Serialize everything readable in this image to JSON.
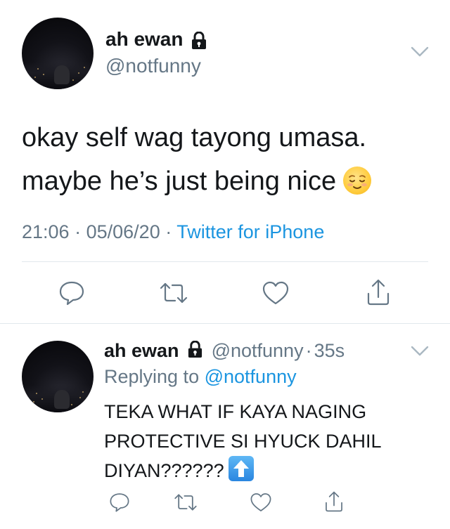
{
  "main_tweet": {
    "display_name": "ah ewan",
    "handle": "@notfunny",
    "text_line1": "okay self wag tayong umasa.",
    "text_line2": "maybe he’s just being nice",
    "time": "21:06",
    "separator": "·",
    "date": "05/06/20",
    "source": "Twitter for iPhone"
  },
  "reply_tweet": {
    "display_name": "ah ewan",
    "handle": "@notfunny",
    "dot": "·",
    "age": "35s",
    "replying_prefix": "Replying to",
    "replying_to": "@notfunny",
    "text_line1": "TEKA WHAT IF KAYA NAGING",
    "text_line2": "PROTECTIVE SI HYUCK DAHIL",
    "text_line3": "DIYAN??????"
  },
  "colors": {
    "text": "#14171a",
    "muted": "#657786",
    "link": "#1b95e0",
    "divider": "#e1e8ed"
  },
  "icons": [
    "lock-icon",
    "chevron-down-icon",
    "reply-icon",
    "retweet-icon",
    "like-icon",
    "share-icon",
    "relieved-face-emoji",
    "up-arrow-emoji"
  ]
}
